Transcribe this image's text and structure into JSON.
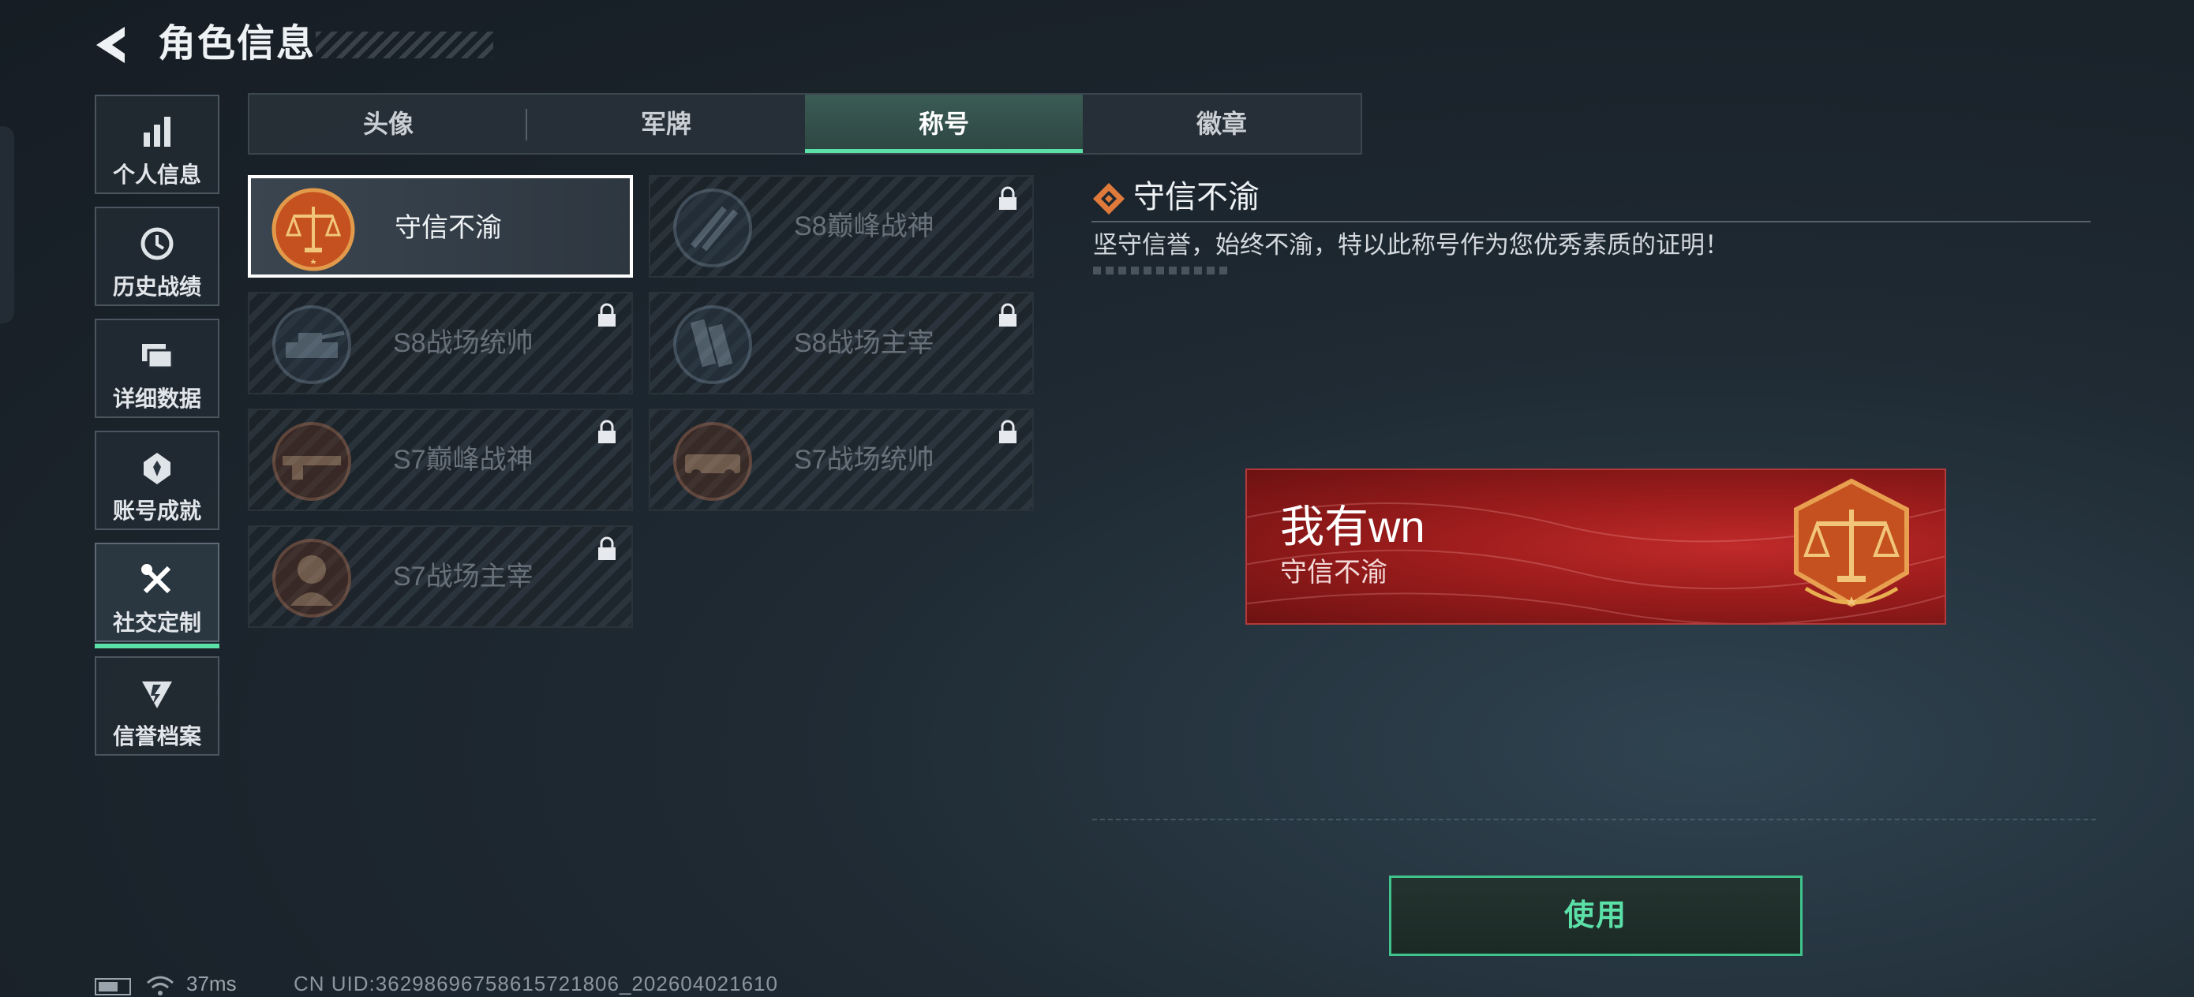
{
  "header": {
    "title": "角色信息"
  },
  "sidebar": {
    "items": [
      {
        "label": "个人信息",
        "icon": "bar-chart-icon",
        "active": false
      },
      {
        "label": "历史战绩",
        "icon": "history-icon",
        "active": false
      },
      {
        "label": "详细数据",
        "icon": "folder-icon",
        "active": false
      },
      {
        "label": "账号成就",
        "icon": "achievement-icon",
        "active": false
      },
      {
        "label": "社交定制",
        "icon": "tools-icon",
        "active": true
      },
      {
        "label": "信誉档案",
        "icon": "credit-icon",
        "active": false
      }
    ]
  },
  "tabs": [
    {
      "label": "头像",
      "active": false
    },
    {
      "label": "军牌",
      "active": false
    },
    {
      "label": "称号",
      "active": true
    },
    {
      "label": "徽章",
      "active": false
    }
  ],
  "titles": [
    {
      "name": "守信不渝",
      "locked": false,
      "selected": true
    },
    {
      "name": "S8巅峰战神",
      "locked": true,
      "selected": false
    },
    {
      "name": "S8战场统帅",
      "locked": true,
      "selected": false
    },
    {
      "name": "S8战场主宰",
      "locked": true,
      "selected": false
    },
    {
      "name": "S7巅峰战神",
      "locked": true,
      "selected": false
    },
    {
      "name": "S7战场统帅",
      "locked": true,
      "selected": false
    },
    {
      "name": "S7战场主宰",
      "locked": true,
      "selected": false
    }
  ],
  "detail": {
    "title": "守信不渝",
    "description": "坚守信誉，始终不渝，特以此称号作为您优秀素质的证明！"
  },
  "banner": {
    "player_name": "我有wn",
    "title": "守信不渝"
  },
  "use_button": "使用",
  "status": {
    "ping": "37ms",
    "uid": "CN UID:3629869675861572​1806_202604021610"
  },
  "colors": {
    "accent": "#5be0a8",
    "banner_red": "#9c1c1c",
    "emblem_orange": "#c4511f"
  }
}
